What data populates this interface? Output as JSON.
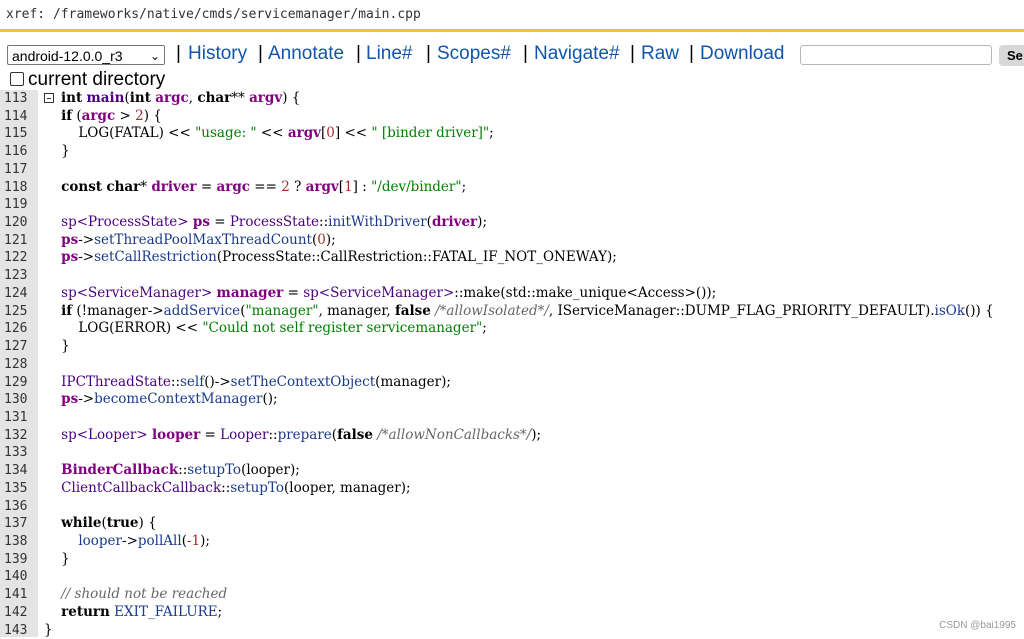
{
  "xref": "xref: /frameworks/native/cmds/servicemanager/main.cpp",
  "branch": "android-12.0.0_r3",
  "nav": [
    "History",
    "Annotate",
    "Line#",
    "Scopes#",
    "Navigate#",
    "Raw",
    "Download"
  ],
  "search_button": "Se",
  "current_directory": "current directory",
  "watermark": "CSDN @bai1995",
  "lines": [
    {
      "n": "113",
      "h": "<span class='kw'>int</span> <span class='fn'>main</span>(<span class='kw'>int</span> <span class='var'>argc</span>, <span class='kw'>char</span>** <span class='var'>argv</span>) {"
    },
    {
      "n": "114",
      "h": "    <span class='kw'>if</span> (<span class='var'>argc</span> &gt; <span class='num'>2</span>) {"
    },
    {
      "n": "115",
      "h": "        LOG(FATAL) &lt;&lt; <span class='str'>\"usage: \"</span> &lt;&lt; <span class='var'>argv</span>[<span class='num'>0</span>] &lt;&lt; <span class='str'>\" [binder driver]\"</span>;"
    },
    {
      "n": "116",
      "h": "    }"
    },
    {
      "n": "117",
      "h": ""
    },
    {
      "n": "118",
      "h": "    <span class='kw'>const</span> <span class='kw'>char</span>* <span class='var'>driver</span> = <span class='var'>argc</span> == <span class='num'>2</span> ? <span class='var'>argv</span>[<span class='num'>1</span>] : <span class='str'>\"/dev/binder\"</span>;"
    },
    {
      "n": "119",
      "h": ""
    },
    {
      "n": "120",
      "h": "    <span class='ty'>sp&lt;ProcessState&gt;</span> <span class='var'>ps</span> = <span class='ty'>ProcessState</span>::<span class='sym'>initWithDriver</span>(<span class='var'>driver</span>);"
    },
    {
      "n": "121",
      "h": "    <span class='var'>ps</span>-&gt;<span class='sym'>setThreadPoolMaxThreadCount</span>(<span class='num'>0</span>);"
    },
    {
      "n": "122",
      "h": "    <span class='var'>ps</span>-&gt;<span class='sym'>setCallRestriction</span>(ProcessState::CallRestriction::FATAL_IF_NOT_ONEWAY);"
    },
    {
      "n": "123",
      "h": ""
    },
    {
      "n": "124",
      "h": "    <span class='ty'>sp&lt;ServiceManager&gt;</span> <span class='var'>manager</span> = <span class='ty'>sp&lt;ServiceManager&gt;</span>::make(std::make_unique&lt;Access&gt;());"
    },
    {
      "n": "125",
      "h": "    <span class='kw'>if</span> (!manager-&gt;<span class='sym'>addService</span>(<span class='str'>\"manager\"</span>, manager, <span class='kw'>false</span> <span class='cm'>/*allowIsolated*/</span>, IServiceManager::DUMP_FLAG_PRIORITY_DEFAULT).<span class='sym'>isOk</span>()) {"
    },
    {
      "n": "126",
      "h": "        LOG(ERROR) &lt;&lt; <span class='str'>\"Could not self register servicemanager\"</span>;"
    },
    {
      "n": "127",
      "h": "    }"
    },
    {
      "n": "128",
      "h": ""
    },
    {
      "n": "129",
      "h": "    <span class='ty'>IPCThreadState</span>::<span class='sym'>self</span>()-&gt;<span class='sym'>setTheContextObject</span>(manager);"
    },
    {
      "n": "130",
      "h": "    <span class='var'>ps</span>-&gt;<span class='sym'>becomeContextManager</span>();"
    },
    {
      "n": "131",
      "h": ""
    },
    {
      "n": "132",
      "h": "    <span class='ty'>sp&lt;Looper&gt;</span> <span class='var'>looper</span> = <span class='ty'>Looper</span>::<span class='sym'>prepare</span>(<span class='kw'>false</span> <span class='cm'>/*allowNonCallbacks*/</span>);"
    },
    {
      "n": "133",
      "h": ""
    },
    {
      "n": "134",
      "h": "    <span class='var'>BinderCallback</span>::<span class='sym'>setupTo</span>(looper);"
    },
    {
      "n": "135",
      "h": "    <span class='ty'>ClientCallbackCallback</span>::<span class='sym'>setupTo</span>(looper, manager);"
    },
    {
      "n": "136",
      "h": ""
    },
    {
      "n": "137",
      "h": "    <span class='kw'>while</span>(<span class='kw'>true</span>) {"
    },
    {
      "n": "138",
      "h": "        <span class='sym'>looper</span>-&gt;<span class='sym'>pollAll</span>(<span class='num'>-1</span>);"
    },
    {
      "n": "139",
      "h": "    }"
    },
    {
      "n": "140",
      "h": ""
    },
    {
      "n": "141",
      "h": "    <span class='cm'>// should not be reached</span>"
    },
    {
      "n": "142",
      "h": "    <span class='kw'>return</span> <span class='sym'>EXIT_FAILURE</span>;"
    },
    {
      "n": "143",
      "h": "}"
    }
  ]
}
